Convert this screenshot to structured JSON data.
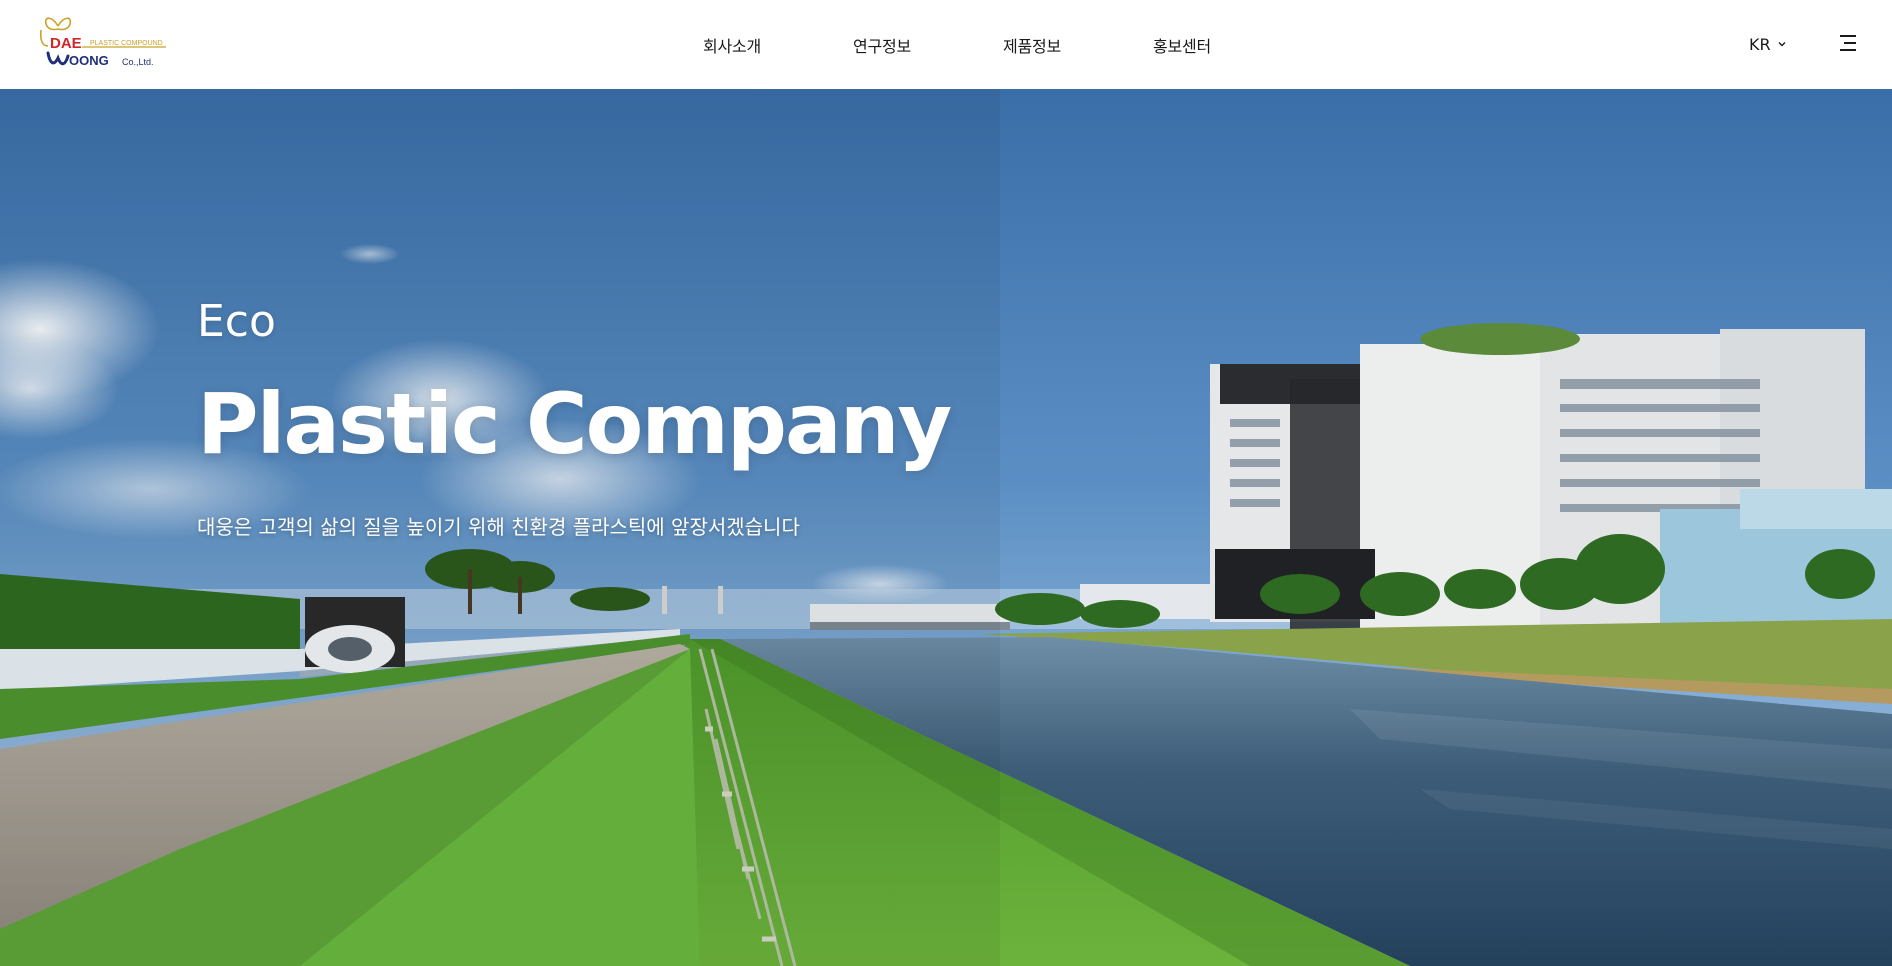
{
  "header": {
    "logo": {
      "word1": "DAE",
      "word2": "OONG",
      "tagline": "PLASTIC COMPOUND",
      "suffix": "Co.,Ltd."
    },
    "nav": [
      {
        "label": "회사소개"
      },
      {
        "label": "연구정보"
      },
      {
        "label": "제품정보"
      },
      {
        "label": "홍보센터"
      }
    ],
    "language": {
      "selected": "KR",
      "icon": "chevron-down-icon"
    },
    "menu_icon": "hamburger-menu-icon"
  },
  "hero": {
    "eyebrow": "Eco",
    "headline": "Plastic Company",
    "tagline": "대웅은 고객의 삶의 질을 높이기 위해 친환경 플라스틱에 앞장서겠습니다"
  },
  "colors": {
    "sky_top": "#3a73b3",
    "sky_bottom": "#a9c9e6",
    "grass": "#5fa334",
    "water": "#2d4e6b",
    "logo_red": "#d0272a",
    "logo_navy": "#1f2f7a",
    "logo_gold": "#c9a228"
  }
}
